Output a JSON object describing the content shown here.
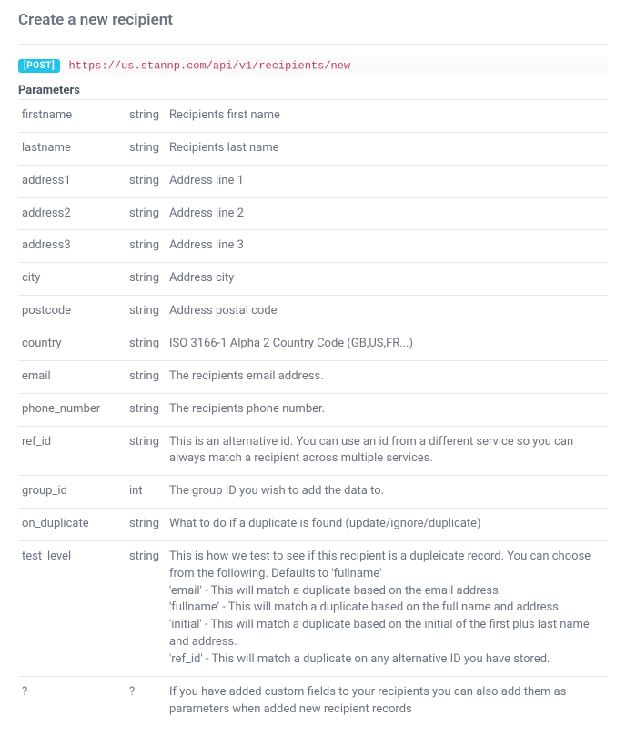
{
  "heading": "Create a new recipient",
  "method_badge": "[POST]",
  "url": "https://us.stannp.com/api/v1/recipients/new",
  "section_title": "Parameters",
  "params": [
    {
      "name": "firstname",
      "type": "string",
      "desc": "Recipients first name"
    },
    {
      "name": "lastname",
      "type": "string",
      "desc": "Recipients last name"
    },
    {
      "name": "address1",
      "type": "string",
      "desc": "Address line 1"
    },
    {
      "name": "address2",
      "type": "string",
      "desc": "Address line 2"
    },
    {
      "name": "address3",
      "type": "string",
      "desc": "Address line 3"
    },
    {
      "name": "city",
      "type": "string",
      "desc": "Address city"
    },
    {
      "name": "postcode",
      "type": "string",
      "desc": "Address postal code"
    },
    {
      "name": "country",
      "type": "string",
      "desc": "ISO 3166-1 Alpha 2 Country Code (GB,US,FR...)"
    },
    {
      "name": "email",
      "type": "string",
      "desc": "The recipients email address."
    },
    {
      "name": "phone_number",
      "type": "string",
      "desc": "The recipients phone number."
    },
    {
      "name": "ref_id",
      "type": "string",
      "desc": "This is an alternative id. You can use an id from a different service so you can always match a recipient across multiple services."
    },
    {
      "name": "group_id",
      "type": "int",
      "desc": "The group ID you wish to add the data to."
    },
    {
      "name": "on_duplicate",
      "type": "string",
      "desc": "What to do if a duplicate is found (update/ignore/duplicate)"
    },
    {
      "name": "test_level",
      "type": "string",
      "desc": "This is how we test to see if this recipient is a dupleicate record. You can choose from the following. Defaults to 'fullname'\n'email' - This will match a duplicate based on the email address.\n'fullname' - This will match a duplicate based on the full name and address.\n'initial' - This will match a duplicate based on the initial of the first plus last name and address.\n'ref_id' - This will match a duplicate on any alternative ID you have stored."
    },
    {
      "name": "?",
      "type": "?",
      "desc": "If you have added custom fields to your recipients you can also add them as parameters when added new recipient records"
    }
  ]
}
